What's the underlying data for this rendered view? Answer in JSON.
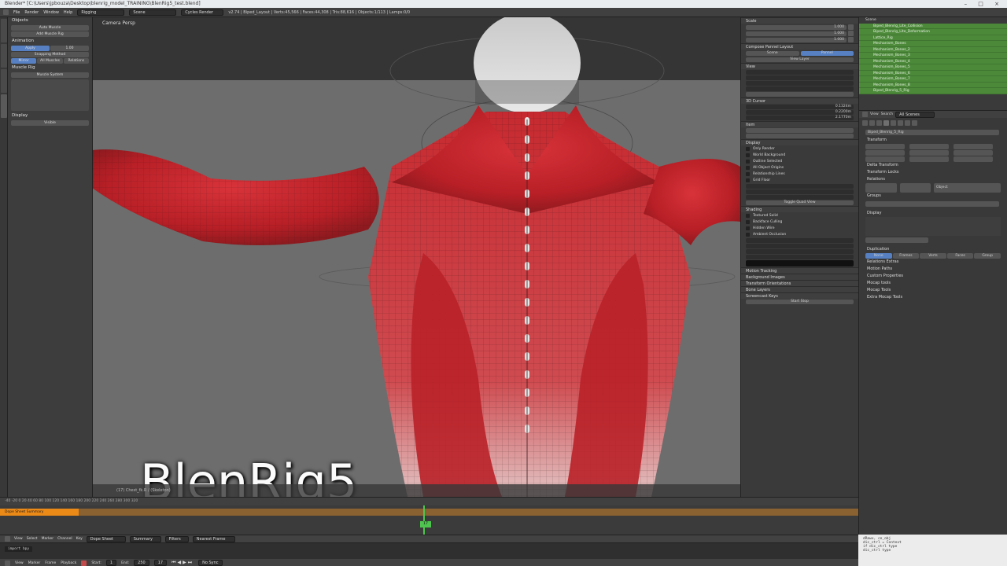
{
  "titlebar": {
    "title": "Blender* [C:\\Users\\jpbouza\\Desktop\\blenrig_model_TRAINING\\BlenRig5_test.blend]",
    "controls": "– □ ×"
  },
  "infobar": {
    "menus": [
      "File",
      "Render",
      "Window",
      "Help"
    ],
    "layout": "Rigging",
    "scene": "Scene",
    "engine": "Cycles Render",
    "stats": "v2.74 | Biped_Layout | Verts:45,566 | Faces:44,308 | Tris:88,616 | Objects:1/113 | Lamps:0/0"
  },
  "toolshelf": {
    "sections": [
      "Objects",
      "Animation",
      "Muscle Rig"
    ],
    "buttons": [
      "Auto Muscle",
      "Add Muscle Rig",
      "Apply",
      "Snapping Method",
      "Relations"
    ],
    "options": [
      "Mirror",
      "All Muscles",
      "Muscle System"
    ],
    "value": "1.00",
    "display_label": "Display",
    "visible_label": "Visible"
  },
  "viewport": {
    "camera_label": "Camera Persp",
    "overlay_title": "BlenRig5",
    "status": "(17) Chest_fk.R / (Skeleton)"
  },
  "nprops": {
    "sections": [
      "Scale",
      "Compose Pannel Layout",
      "View",
      "3D Cursor",
      "Item",
      "Display",
      "Shading",
      "Motion Tracking",
      "Background Images",
      "Transform Orientations",
      "Bone Layers",
      "Screencast Keys"
    ],
    "tabs": [
      "Scene",
      "Pannel"
    ],
    "view_layer_label": "View Layer",
    "checks": [
      "Only Render",
      "World Background",
      "Outline Selected",
      "All Object Origins",
      "Relationship Lines",
      "Grid Floor"
    ],
    "shading_checks": [
      "Textured Solid",
      "Backface Culling",
      "Hidden Wire",
      "Ambient Occlusion"
    ],
    "toggle_label": "Toggle Quad View",
    "scale_values": [
      "1.000",
      "1.000",
      "1.000"
    ],
    "location_values": [
      "0.1324m",
      "0.2200m",
      "2.1770m"
    ],
    "start_stop": "Start Stop"
  },
  "outliner": {
    "scene": "Scene",
    "rows": [
      "Biped_Blenrig_Lite_Collision",
      "Biped_Blenrig_Lite_Deformation",
      "Lattice_Rig",
      "Mechanism_Bones",
      "Mechanism_Bones_2",
      "Mechanism_Bones_3",
      "Mechanism_Bones_4",
      "Mechanism_Bones_5",
      "Mechanism_Bones_6",
      "Mechanism_Bones_7",
      "Mechanism_Bones_8",
      "Biped_Blenrig_5_Rig"
    ]
  },
  "properties": {
    "header_items": [
      "View",
      "Search",
      "All Scenes"
    ],
    "object_name": "Biped_Blenrig_5_Rig",
    "sections": [
      "Transform",
      "Delta Transform",
      "Transform Locks",
      "Relations",
      "Groups",
      "Display",
      "Duplication",
      "Relations Extras",
      "Motion Paths",
      "Custom Properties",
      "Mocap tools",
      "Mocap Tools",
      "Extra Mocap Tools"
    ],
    "dup_tabs": [
      "None",
      "Frames",
      "Verts",
      "Faces",
      "Group"
    ],
    "parent_type": "Object"
  },
  "console": {
    "lines": [
      "dRawx, ce_obj",
      "dic_ctrl = Context",
      "if dic_ctrl type",
      "dic_ctrl type"
    ]
  },
  "dopesheet": {
    "summary_label": "Dope Sheet Summary",
    "frame": "17",
    "ruler": "-40  -20   0   20   40   60   80   100   120   140   160   180   200   220   240   260   280   300   320"
  },
  "ds_header": {
    "items": [
      "View",
      "Select",
      "Marker",
      "Channel",
      "Key"
    ],
    "mode": "Dope Sheet",
    "summary": "Summary",
    "filter": "Filters",
    "keyframe_type": "Nearest Frame"
  },
  "timeline": {
    "items": [
      "View",
      "Marker",
      "Frame",
      "Playback"
    ],
    "start_label": "Start:",
    "start": "1",
    "end_label": "End:",
    "end": "250",
    "current": "17",
    "sync": "No Sync"
  },
  "console_prompt": "import bpy"
}
